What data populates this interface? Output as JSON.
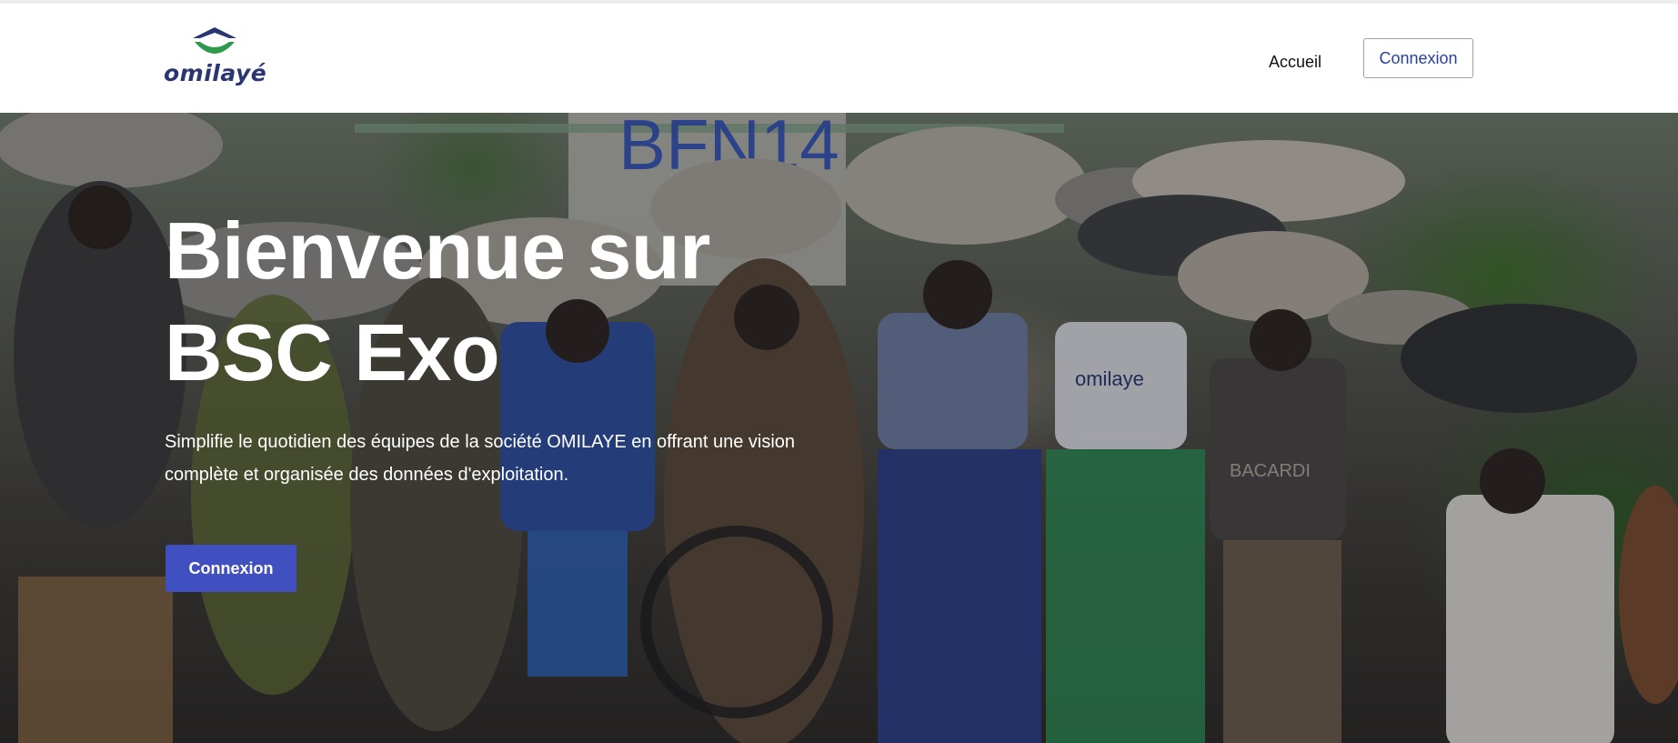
{
  "brand": {
    "logo_text": "omilayé",
    "logo_colors": {
      "roof": "#2a3672",
      "arc": "#2f9a4c"
    }
  },
  "nav": {
    "home_label": "Accueil",
    "login_label": "Connexion"
  },
  "hero": {
    "title_line1": "Bienvenue sur",
    "title_line2": "BSC Exo",
    "description": "Simplifie le quotidien des équipes de la société OMILAYE en offrant une vision complète et organisée des données d'exploitation.",
    "cta_label": "Connexion",
    "background_image": "photo of children and women carrying water basins on their heads",
    "photo_signs": {
      "wall_sign": "BFN14",
      "tshirt_text": "omilaye",
      "shirt_text": "BACARDI"
    }
  },
  "colors": {
    "primary": "#4150c0",
    "link_primary": "#2a3f9c",
    "header_bg": "#ffffff"
  }
}
